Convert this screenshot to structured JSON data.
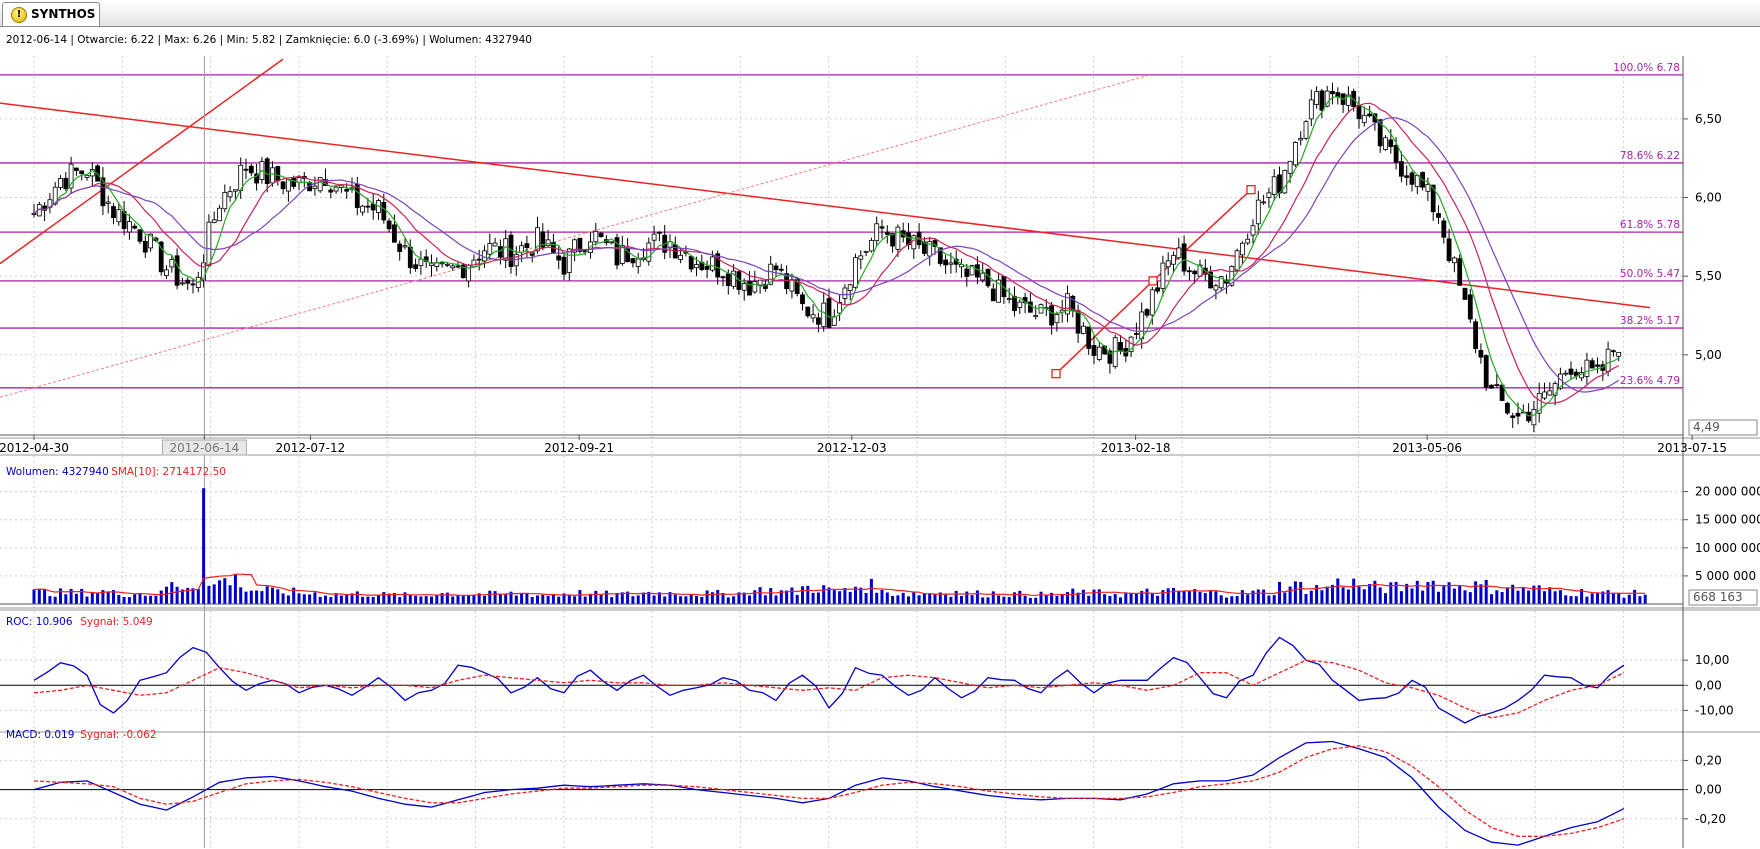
{
  "tab": {
    "label": "SYNTHOS",
    "icon": "warning-icon"
  },
  "chart_data": [
    {
      "type": "candlestick",
      "panel": "price",
      "info": {
        "date": "2012-06-14",
        "open_label": "Otwarcie",
        "open": "6.22",
        "high_label": "Max",
        "high": "6.26",
        "low_label": "Min",
        "low": "5.82",
        "close_label": "Zamknięcie",
        "close": "6.0 (-3.69%)",
        "volume_label": "Wolumen",
        "volume": "4327940"
      },
      "x_ticks": [
        "2012-04-30",
        "2012-06-14",
        "2012-07-12",
        "2012-09-21",
        "2012-12-03",
        "2013-02-18",
        "2013-05-06",
        "2013-07-15"
      ],
      "x_ticks_week_index": [
        0,
        6.43,
        10.43,
        20.57,
        30.86,
        41.57,
        52.57,
        62.57
      ],
      "y_ticks": [
        "6,50",
        "6,00",
        "5,50",
        "5,00"
      ],
      "y_tick_values": [
        6.5,
        6.0,
        5.5,
        5.0
      ],
      "ylim": [
        4.49,
        6.9
      ],
      "last_value_label": "4,49",
      "selected_date_index": 6.43,
      "fibonacci_levels": [
        {
          "label": "100.0% 6.78",
          "value": 6.78
        },
        {
          "label": "78.6% 6.22",
          "value": 6.22
        },
        {
          "label": "61.8% 5.78",
          "value": 5.78
        },
        {
          "label": "50.0% 5.47",
          "value": 5.47
        },
        {
          "label": "38.2% 5.17",
          "value": 5.17
        },
        {
          "label": "23.6% 4.79",
          "value": 4.79
        }
      ],
      "colors": {
        "fibonacci": "#aa22aa",
        "trendline": "#ee2222",
        "candle": "#000000",
        "ma_fast": "#22aa22",
        "ma_mid": "#cc2255",
        "ma_slow": "#7a44bb"
      },
      "close_weekly": [
        5.9,
        6.12,
        6.18,
        5.92,
        5.78,
        5.55,
        5.42,
        5.98,
        6.2,
        6.12,
        6.08,
        6.15,
        5.98,
        5.92,
        5.65,
        5.5,
        5.55,
        5.68,
        5.65,
        5.72,
        5.58,
        5.78,
        5.62,
        5.7,
        5.72,
        5.6,
        5.55,
        5.45,
        5.55,
        5.3,
        5.25,
        5.6,
        5.8,
        5.7,
        5.62,
        5.5,
        5.45,
        5.3,
        5.25,
        5.3,
        5.05,
        5.02,
        5.3,
        5.65,
        5.5,
        5.5,
        5.9,
        6.1,
        6.55,
        6.7,
        6.55,
        6.3,
        6.15,
        5.9,
        5.3,
        4.75,
        4.6,
        4.72,
        4.95,
        4.85,
        5.15
      ]
    },
    {
      "type": "bar",
      "panel": "volume",
      "legend": [
        {
          "label": "Wolumen",
          "value": "4327940",
          "color": "#0000cc"
        },
        {
          "label": "SMA[10]",
          "value": "2714172.50",
          "color": "#ee2222"
        }
      ],
      "y_ticks": [
        "20 000 000",
        "15 000 000",
        "10 000 000",
        "5 000 000"
      ],
      "y_tick_values": [
        20000000,
        15000000,
        10000000,
        5000000
      ],
      "ylim": [
        0,
        21000000
      ],
      "last_value_label": "668 163",
      "volume_weekly": [
        2100000,
        2000000,
        2200000,
        1900000,
        1800000,
        3300000,
        20600000,
        4200000,
        2500000,
        2100000,
        1900000,
        1700000,
        1800000,
        1600000,
        1500000,
        1900000,
        1800000,
        1700000,
        1800000,
        1600000,
        1900000,
        1700000,
        1700000,
        2000000,
        1900000,
        1800000,
        1900000,
        2400000,
        2200000,
        2900000,
        2300000,
        3200000,
        2000000,
        1900000,
        2100000,
        1800000,
        1900000,
        1700000,
        1600000,
        2000000,
        1900000,
        1800000,
        2100000,
        2200000,
        1900000,
        1900000,
        2100000,
        3200000,
        2800000,
        3700000,
        3000000,
        2900000,
        3800000,
        3400000,
        3200000,
        2800000,
        2700000,
        2300000,
        2100000,
        1900000,
        1800000
      ]
    },
    {
      "type": "line",
      "panel": "roc",
      "legend": [
        {
          "label": "ROC",
          "value": "10.906",
          "color": "#0000cc"
        },
        {
          "label": "Sygnał",
          "value": "5.049",
          "color": "#ee2222"
        }
      ],
      "y_ticks": [
        "10,00",
        "0,00",
        "-10,00"
      ],
      "y_tick_values": [
        10,
        0,
        -10
      ],
      "ylim": [
        -17,
        22
      ],
      "roc_weekly": [
        2,
        9,
        4,
        -11,
        2,
        5,
        15,
        7,
        -2,
        2,
        -3,
        0,
        -4,
        3,
        -6,
        -2,
        8,
        5,
        -3,
        3,
        -3,
        6,
        -2,
        4,
        -4,
        -1,
        3,
        -2,
        -6,
        4,
        -9,
        7,
        4,
        -4,
        3,
        -5,
        3,
        2,
        -3,
        6,
        -3,
        2,
        2,
        11,
        3,
        -5,
        4,
        19,
        10,
        2,
        -6,
        -5,
        2,
        -9,
        -15,
        -11,
        -6,
        4,
        3,
        -1,
        8
      ],
      "signal_weekly": [
        -3,
        -2,
        0,
        -2,
        -4,
        -3,
        2,
        7,
        5,
        2,
        -1,
        0,
        -1,
        0,
        0,
        -1,
        2,
        4,
        3,
        2,
        1,
        2,
        1,
        1,
        0,
        0,
        1,
        0,
        -1,
        -2,
        -1,
        -2,
        3,
        4,
        3,
        1,
        -1,
        0,
        -1,
        0,
        1,
        0,
        -2,
        0,
        5,
        5,
        0,
        5,
        10,
        9,
        6,
        1,
        -1,
        -4,
        -9,
        -13,
        -11,
        -6,
        -2,
        0,
        5
      ]
    },
    {
      "type": "line",
      "panel": "macd",
      "legend": [
        {
          "label": "MACD",
          "value": "0.019",
          "color": "#0000cc"
        },
        {
          "label": "Sygnał",
          "value": "-0.062",
          "color": "#ee2222"
        }
      ],
      "y_ticks": [
        "0,20",
        "0,00",
        "-0,20"
      ],
      "y_tick_values": [
        0.2,
        0,
        -0.2
      ],
      "ylim": [
        -0.4,
        0.34
      ],
      "macd_weekly": [
        0.0,
        0.05,
        0.06,
        -0.02,
        -0.1,
        -0.14,
        -0.05,
        0.05,
        0.08,
        0.09,
        0.06,
        0.02,
        -0.01,
        -0.06,
        -0.1,
        -0.12,
        -0.07,
        -0.02,
        0.0,
        0.01,
        0.03,
        0.02,
        0.03,
        0.04,
        0.03,
        0.0,
        -0.02,
        -0.04,
        -0.06,
        -0.09,
        -0.06,
        0.03,
        0.08,
        0.06,
        0.02,
        -0.01,
        -0.04,
        -0.06,
        -0.07,
        -0.06,
        -0.06,
        -0.07,
        -0.03,
        0.04,
        0.06,
        0.06,
        0.1,
        0.22,
        0.32,
        0.33,
        0.28,
        0.22,
        0.08,
        -0.12,
        -0.28,
        -0.36,
        -0.38,
        -0.32,
        -0.26,
        -0.22,
        -0.13
      ],
      "signal_weekly": [
        0.06,
        0.05,
        0.04,
        0.02,
        -0.06,
        -0.1,
        -0.08,
        -0.02,
        0.04,
        0.06,
        0.07,
        0.05,
        0.02,
        -0.02,
        -0.06,
        -0.09,
        -0.09,
        -0.06,
        -0.03,
        -0.01,
        0.01,
        0.01,
        0.02,
        0.03,
        0.03,
        0.02,
        0.0,
        -0.02,
        -0.04,
        -0.06,
        -0.06,
        -0.02,
        0.03,
        0.05,
        0.04,
        0.02,
        -0.01,
        -0.03,
        -0.05,
        -0.06,
        -0.06,
        -0.06,
        -0.05,
        -0.02,
        0.02,
        0.04,
        0.06,
        0.12,
        0.22,
        0.28,
        0.3,
        0.26,
        0.16,
        0.02,
        -0.14,
        -0.26,
        -0.32,
        -0.32,
        -0.3,
        -0.26,
        -0.2
      ]
    }
  ]
}
